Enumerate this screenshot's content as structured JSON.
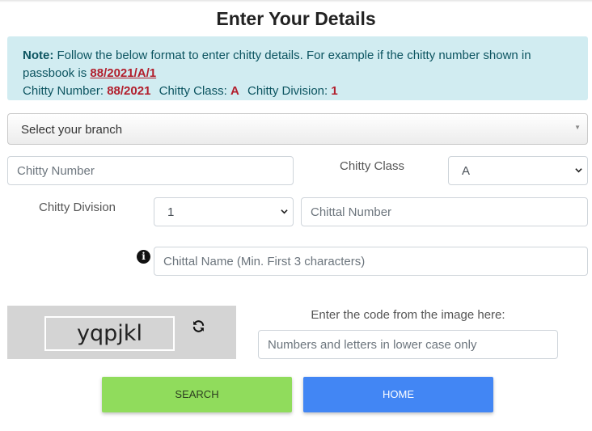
{
  "page": {
    "title": "Enter Your Details"
  },
  "note": {
    "label": "Note:",
    "text": "Follow the below format to enter chitty details. For example if the chitty number shown in passbook is",
    "example": "88/2021/A/1",
    "number_label": "Chitty Number:",
    "number_value": "88/2021",
    "class_label": "Chitty Class:",
    "class_value": "A",
    "division_label": "Chitty Division:",
    "division_value": "1"
  },
  "form": {
    "branch_placeholder": "Select your branch",
    "chitty_number_placeholder": "Chitty Number",
    "chitty_class_label": "Chitty Class",
    "chitty_class_value": "A",
    "chitty_division_label": "Chitty Division",
    "chitty_division_value": "1",
    "chittal_number_placeholder": "Chittal Number",
    "chittal_name_placeholder": "Chittal Name (Min. First 3 characters)"
  },
  "captcha": {
    "code": "yqpjkl",
    "instruction": "Enter the code from the image here:",
    "input_placeholder": "Numbers and letters in lower case only"
  },
  "buttons": {
    "search": "SEARCH",
    "home": "HOME"
  },
  "colors": {
    "note_bg": "#d1ecf1",
    "highlight": "#b21f2d",
    "search_btn": "#90dc5c",
    "home_btn": "#4286f4",
    "captcha_bg": "#d4d4d4"
  }
}
